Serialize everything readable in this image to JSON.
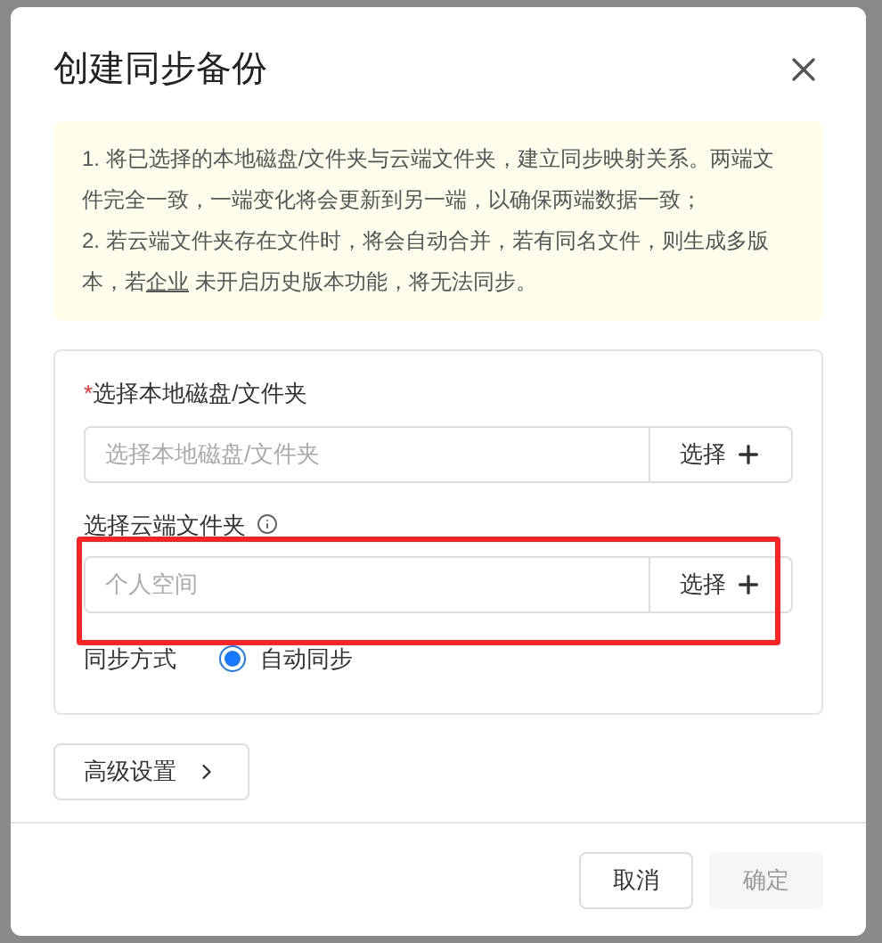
{
  "dialog": {
    "title": "创建同步备份"
  },
  "notice": {
    "item_1": "1. 将已选择的本地磁盘/文件夹与云端文件夹，建立同步映射关系。两端文件完全一致，一端变化将会更新到另一端，以确保两端数据一致；",
    "item_2_before": "2. 若云端文件夹存在文件时，将会自动合并，若有同名文件，则生成多版本，若",
    "item_2_link": "企业",
    "item_2_after": " 未开启历史版本功能，将无法同步。"
  },
  "fields": [
    {
      "label": "选择本地磁盘/文件夹",
      "required_mark": "*",
      "info": false,
      "placeholder": "选择本地磁盘/文件夹",
      "button": "选择",
      "highlighted": false
    },
    {
      "label": "选择云端文件夹",
      "info": true,
      "placeholder": "个人空间",
      "button": "选择",
      "highlighted": true
    }
  ],
  "sync_mode": {
    "label": "同步方式",
    "options": [
      {
        "label": "自动同步",
        "selected": true
      }
    ]
  },
  "advanced_button": "高级设置",
  "footer": [
    {
      "label": "取消",
      "disabled": false
    },
    {
      "label": "确定",
      "disabled": true
    }
  ]
}
